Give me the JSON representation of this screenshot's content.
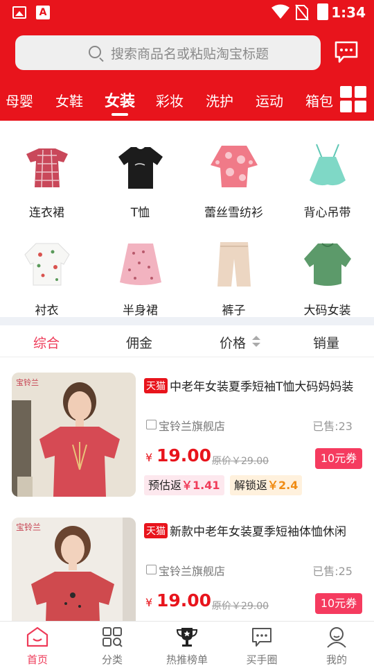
{
  "status_bar": {
    "time": "1:34"
  },
  "search": {
    "placeholder": "搜索商品名或粘贴淘宝标题"
  },
  "categories": [
    "母婴",
    "女鞋",
    "女装",
    "彩妆",
    "洗护",
    "运动",
    "箱包"
  ],
  "active_category": "女装",
  "subcategories": [
    "连衣裙",
    "T恤",
    "蕾丝雪纺衫",
    "背心吊带",
    "衬衣",
    "半身裙",
    "裤子",
    "大码女装"
  ],
  "sort_tabs": [
    "综合",
    "佣金",
    "价格",
    "销量"
  ],
  "active_sort": "综合",
  "products": [
    {
      "badge": "天猫",
      "title": "中老年女装夏季短袖T恤大码妈妈装",
      "shop": "宝铃兰旗舰店",
      "sold": "已售:23",
      "currency": "¥",
      "price": "19.00",
      "original_price": "原价￥29.00",
      "coupon": "10元券",
      "rebate_label": "预估返",
      "rebate_value": "￥1.41",
      "unlock_label": "解锁返",
      "unlock_value": "￥2.4",
      "brand_mark": "宝铃兰"
    },
    {
      "badge": "天猫",
      "title": "新款中老年女装夏季短袖体恤休闲",
      "shop": "宝铃兰旗舰店",
      "sold": "已售:25",
      "currency": "¥",
      "price": "19.00",
      "original_price": "原价￥29.00",
      "coupon": "10元券",
      "brand_mark": "宝铃兰"
    }
  ],
  "bottom_nav": [
    "首页",
    "分类",
    "热推榜单",
    "买手圈",
    "我的"
  ],
  "active_nav": "首页",
  "colors": {
    "brand_red": "#e8141c",
    "accent_pink": "#ee3a58",
    "coupon_pink": "#f53b5f"
  }
}
